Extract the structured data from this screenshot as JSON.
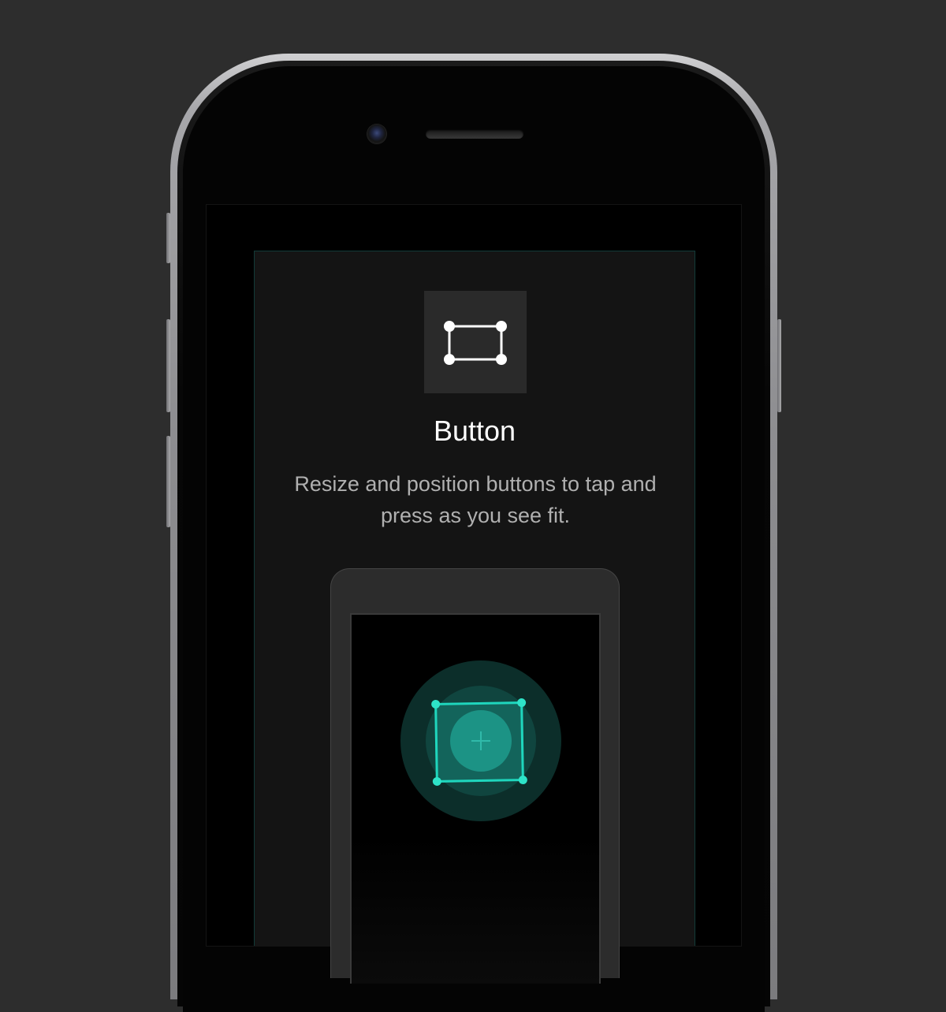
{
  "device": {
    "model": "phone-mockup"
  },
  "onboarding": {
    "icon": "resize-frame-icon",
    "title": "Button",
    "description": "Resize and position buttons to tap and press as you see fit."
  },
  "illustration": {
    "button_icon": "plus-icon",
    "frame_icon": "selection-frame-icon"
  },
  "colors": {
    "background": "#2d2d2d",
    "card": "#141414",
    "accent": "#1fd6bd",
    "glow_dark": "#0c2e2a",
    "glow_mid": "#10453f",
    "glow_core": "#1c8075",
    "text_primary": "#ffffff",
    "text_secondary": "#b0b0b0"
  }
}
